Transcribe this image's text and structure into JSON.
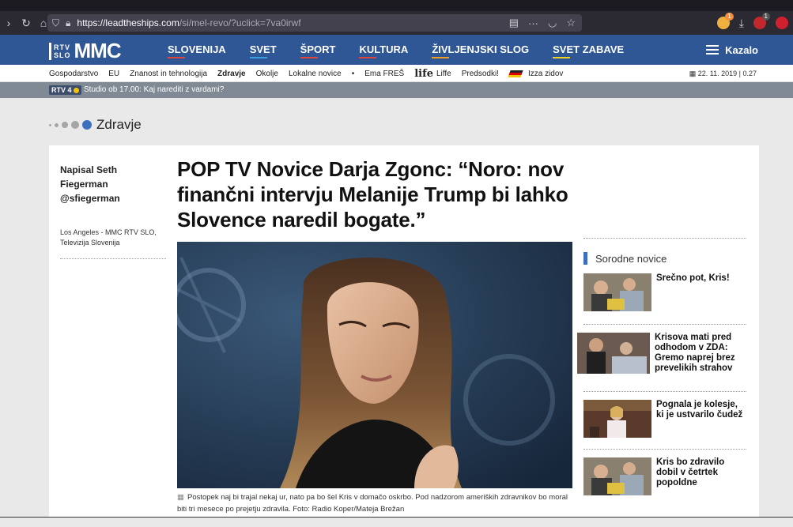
{
  "browser": {
    "url_host": "https://leadtheships.com",
    "url_path": "/si/mel-revo/?uclick=7va0irwf",
    "menu_glyph": "···",
    "ext_badge_1": "1",
    "ext_badge_2": "1"
  },
  "site": {
    "logo_rtv_top": "RTV",
    "logo_rtv_bottom": "SLO",
    "logo_mmc": "MMC",
    "nav": [
      {
        "label": "SLOVENIJA",
        "color": "#e0453c"
      },
      {
        "label": "SVET",
        "color": "#3aa0e0"
      },
      {
        "label": "ŠPORT",
        "color": "#e0453c"
      },
      {
        "label": "KULTURA",
        "color": "#e0453c"
      },
      {
        "label": "ŽIVLJENJSKI SLOG",
        "color": "#f0a020"
      },
      {
        "label": "SVET ZABAVE",
        "color": "#f0d020"
      }
    ],
    "menu_label": "Kazalo"
  },
  "subnav": {
    "items": [
      "Gospodarstvo",
      "EU",
      "Znanost in tehnologija",
      "Zdravje",
      "Okolje",
      "Lokalne novice",
      "•",
      "Ema FREŠ"
    ],
    "life_logo": "life",
    "items2": [
      "Liffe",
      "Predsodki!"
    ],
    "items3": [
      "Izza zidov"
    ],
    "date": "22. 11. 2019 | 0.27"
  },
  "ticker": {
    "badge": "RTV 4",
    "text": "Studio ob 17.00: Kaj narediti z vardami?"
  },
  "section": {
    "label": "Zdravje"
  },
  "article": {
    "author": "Napisal Seth Fiegerman @sfiegerman",
    "dateline": "Los Angeles - MMC RTV SLO, Televizija Slovenija",
    "headline": "POP TV Novice Darja Zgonc: “Noro: nov finančni intervju Melanije Trump bi lahko Slovence naredil bogate.”",
    "caption": "Postopek naj bi trajal nekaj ur, nato pa bo šel Kris v domačo oskrbo. Pod nadzorom ameriških zdravnikov bo moral biti tri mesece po prejetju zdravila. Foto: Radio Koper/Mateja Brežan"
  },
  "related": {
    "title": "Sorodne novice",
    "items": [
      {
        "title": "Srečno pot, Kris!"
      },
      {
        "title": "Krisova mati pred odhodom v ZDA: Gremo naprej brez prevelikih strahov"
      },
      {
        "title": "Pognala je kolesje, ki je ustvarilo čudež"
      },
      {
        "title": "Kris bo zdravilo dobil v četrtek popoldne"
      }
    ]
  },
  "colors": {
    "brand_blue": "#2f5796",
    "accent_blue": "#3d6fc0",
    "ticker_gray": "#7f8a95"
  }
}
